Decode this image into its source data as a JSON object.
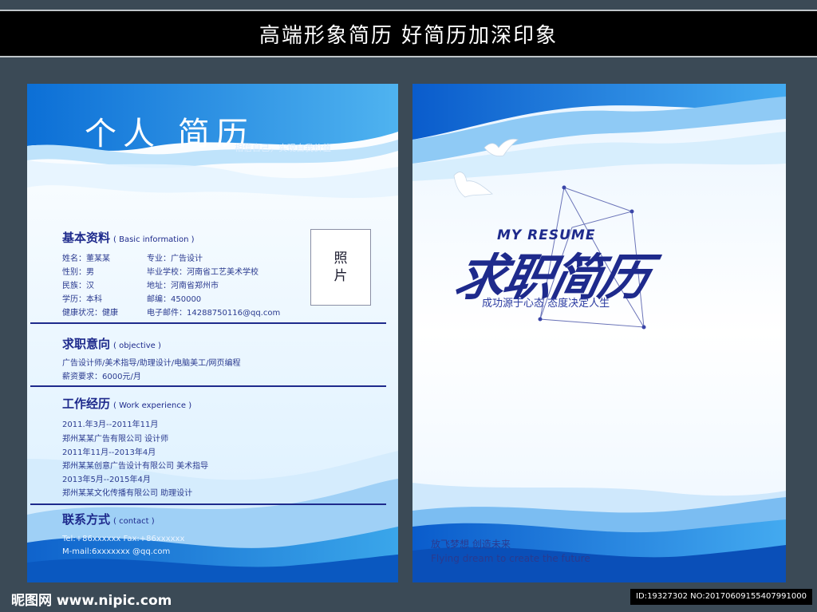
{
  "banner": {
    "text": "高端形象简历  好简历加深印象"
  },
  "left_page": {
    "title": "个人 简历",
    "motto": "相信自己，实现自我价值",
    "basic": {
      "title": "基本资料",
      "title_en": "( Basic information )",
      "rows": [
        {
          "left": "姓名：董某某",
          "right": "专业：广告设计"
        },
        {
          "left": "性别：男",
          "right": "毕业学校：河南省工艺美术学校"
        },
        {
          "left": "民族：汉",
          "right": "地址：河南省郑州市"
        },
        {
          "left": "学历：本科",
          "right": "邮编：450000"
        },
        {
          "left": "健康状况：健康",
          "right": "电子邮件：14288750116@qq.com"
        }
      ],
      "photo": "照片"
    },
    "objective": {
      "title": "求职意向",
      "title_en": "( objective )",
      "lines": [
        "广告设计师/美术指导/助理设计/电脑美工/网页编程",
        "薪资要求：6000元/月"
      ]
    },
    "work": {
      "title": "工作经历",
      "title_en": "( Work experience )",
      "lines": [
        "2011.年3月--2011年11月",
        "郑州某某广告有限公司  设计师",
        "2011年11月--2013年4月",
        "郑州某某创意广告设计有限公司  美术指导",
        "2013年5月--2015年4月",
        "郑州某某文化传播有限公司  助理设计"
      ]
    },
    "contact": {
      "title": "联系方式",
      "title_en": "( contact )",
      "lines": [
        "Tel:+86xxxxxx  Fax:+86xxxxxx",
        "M-mail:6xxxxxxx @qq.com"
      ]
    }
  },
  "right_page": {
    "my_resume": "MY RESUME",
    "big_title": "求职简历",
    "slogan": "成功源于心态 态度决定人生",
    "fly_cn": "放飞梦想  创造未来",
    "fly_en": "Flying dream to create the future"
  },
  "watermark": {
    "logo": "昵图网 www.nipic.com",
    "id": "ID:19327302 NO:20170609155407991000"
  },
  "colors": {
    "navy": "#1e2a8c",
    "sky": "#2a8fe0",
    "banner": "#000000",
    "background": "#3b4a56"
  }
}
